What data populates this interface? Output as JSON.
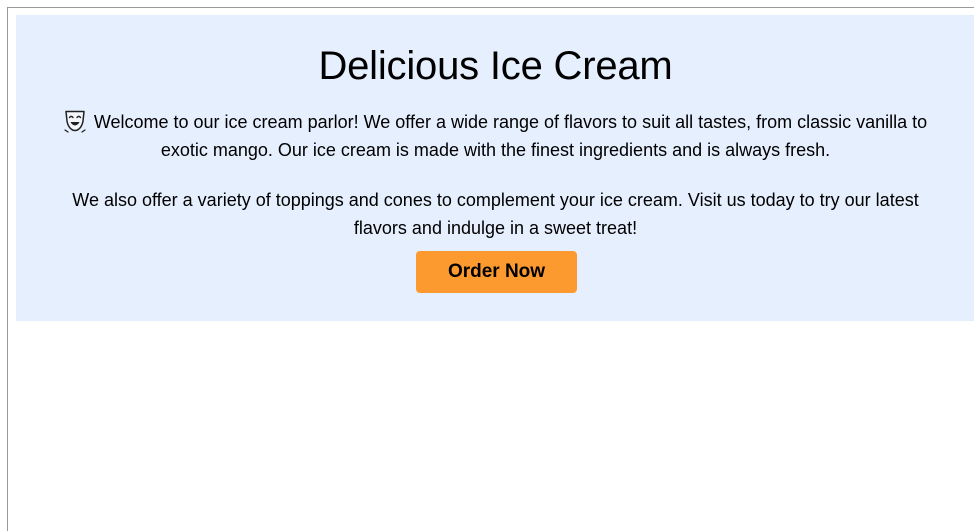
{
  "hero": {
    "title": "Delicious Ice Cream",
    "icon": "theater-mask-icon",
    "paragraph1": "Welcome to our ice cream parlor! We offer a wide range of flavors to suit all tastes, from classic vanilla to exotic mango. Our ice cream is made with the finest ingredients and is always fresh.",
    "paragraph2": "We also offer a variety of toppings and cones to complement your ice cream. Visit us today to try our latest flavors and indulge in a sweet treat!",
    "button_label": "Order Now"
  },
  "colors": {
    "hero_background": "#e6effe",
    "button_background": "#fd9a2f",
    "text": "#000000"
  }
}
